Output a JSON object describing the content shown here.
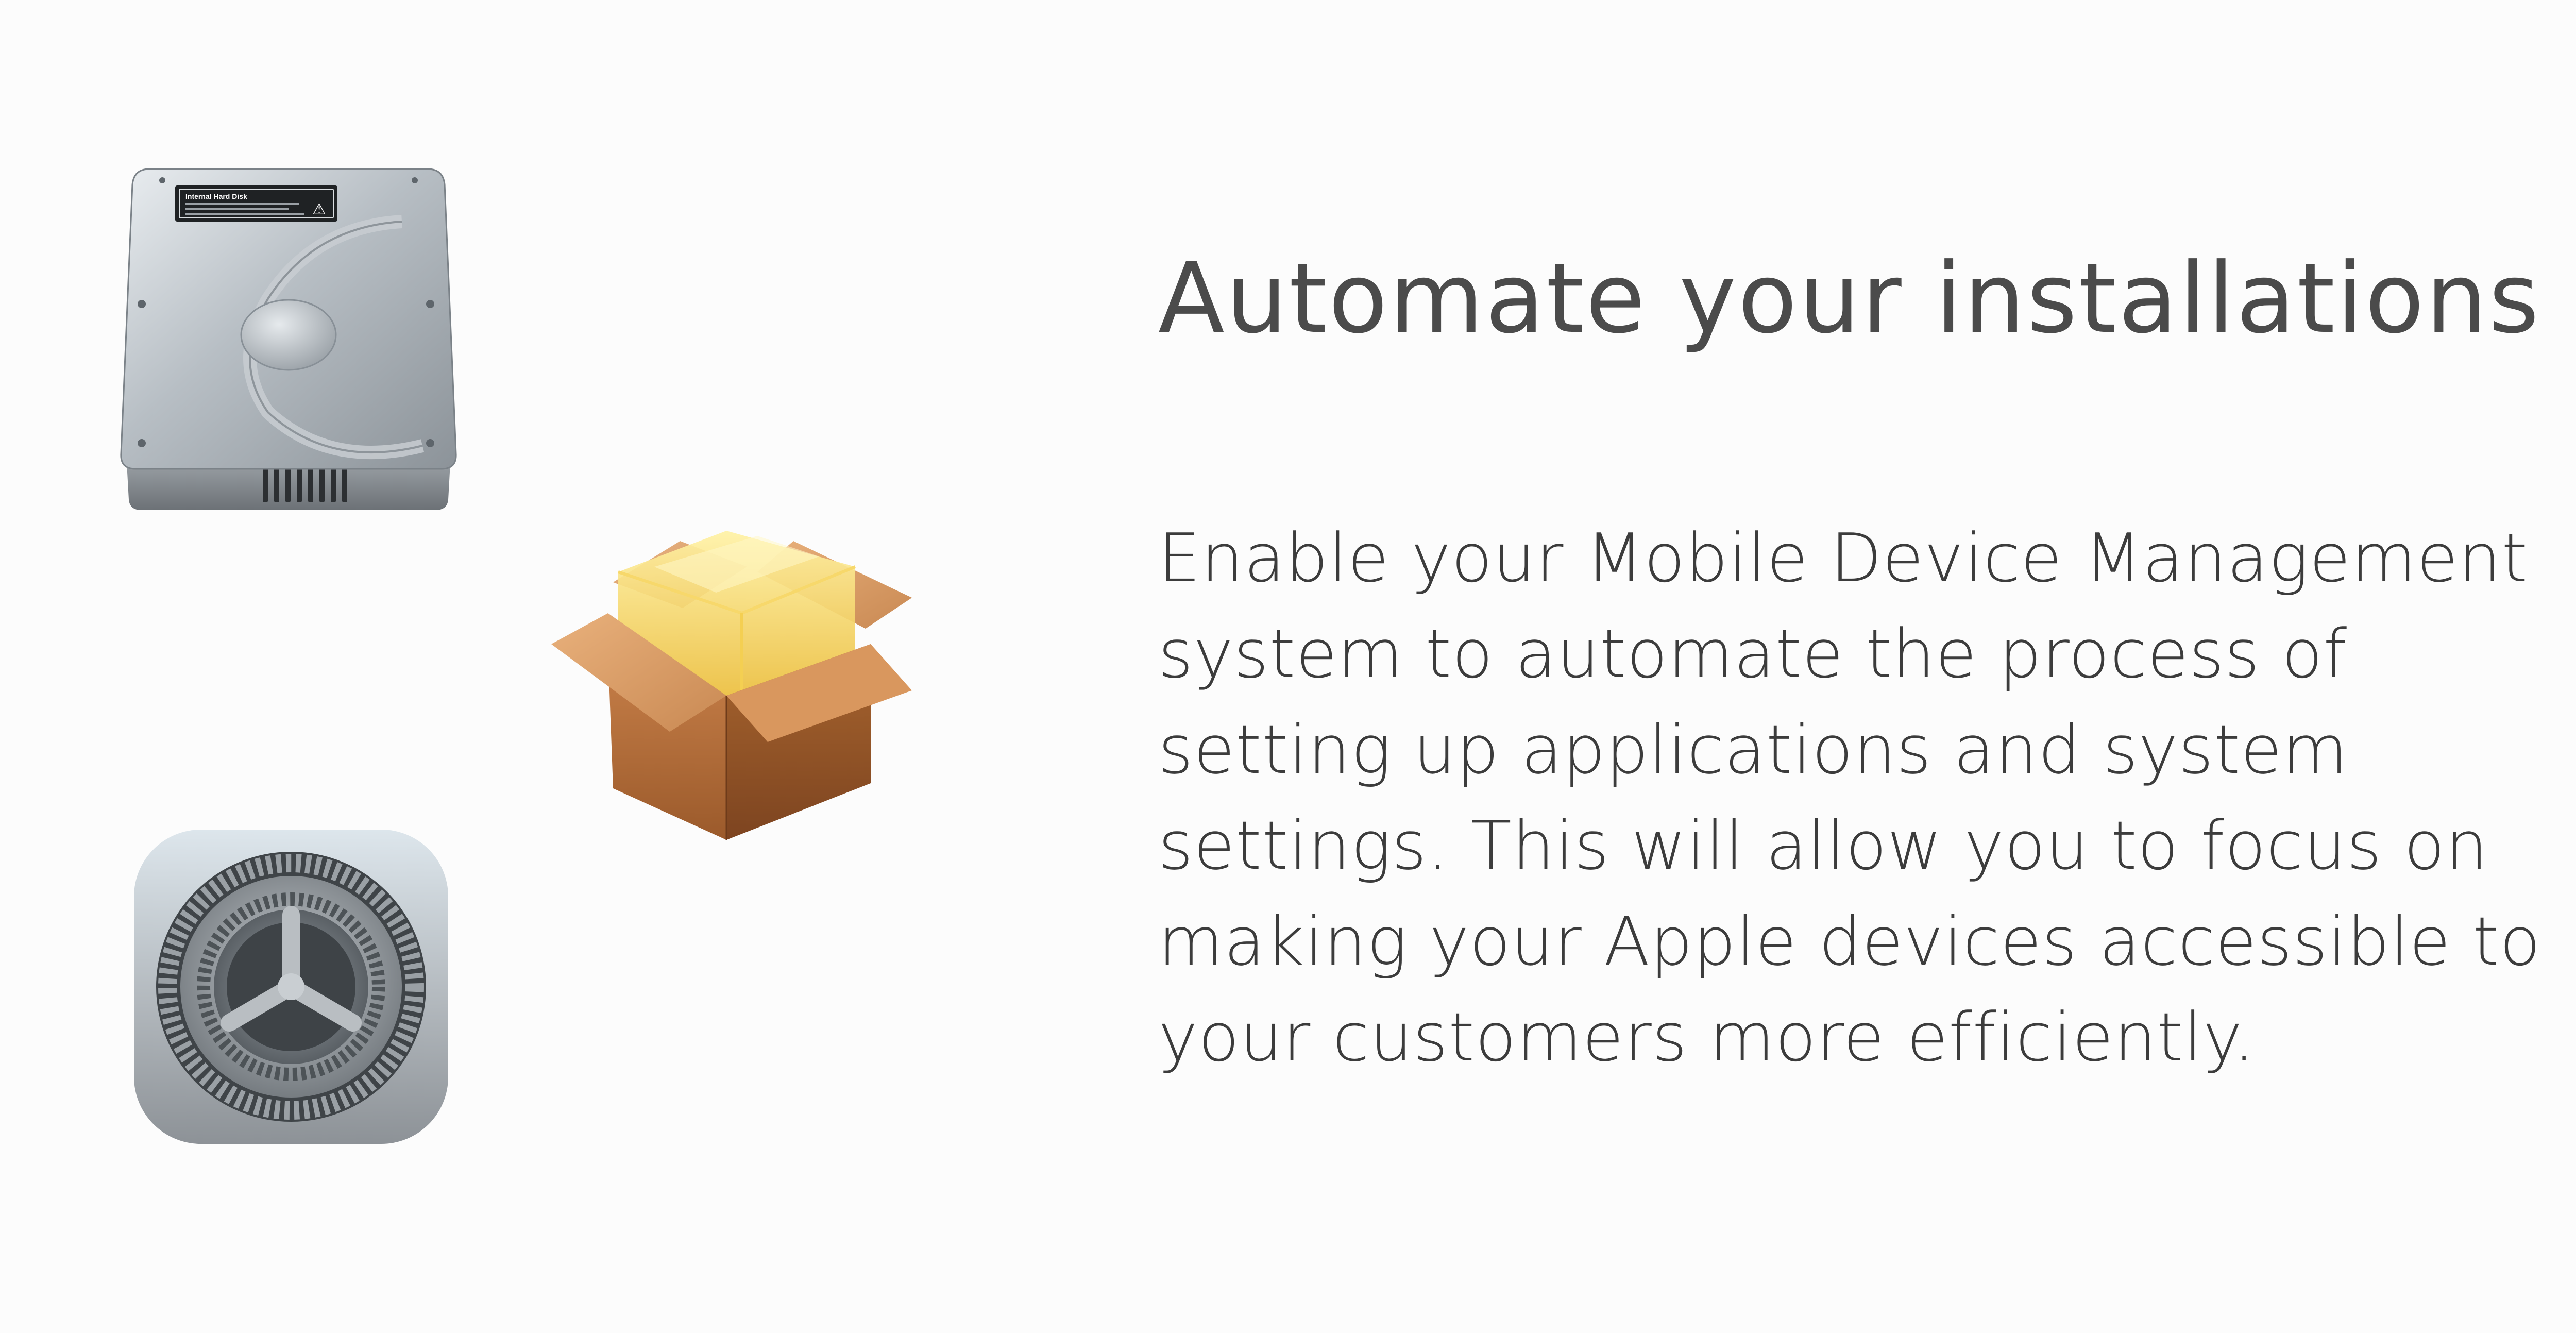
{
  "section": {
    "title": "Automate your installations",
    "description": "Enable your Mobile Device Management system to automate the process of setting up applications and system settings. This will allow you to focus on making your Apple devices accessible to your customers more efficiently."
  },
  "icons": [
    "hard-drive-icon",
    "installer-package-icon",
    "system-preferences-icon"
  ],
  "drive_label": {
    "title": "Internal Hard Disk",
    "warning": "⚠"
  }
}
